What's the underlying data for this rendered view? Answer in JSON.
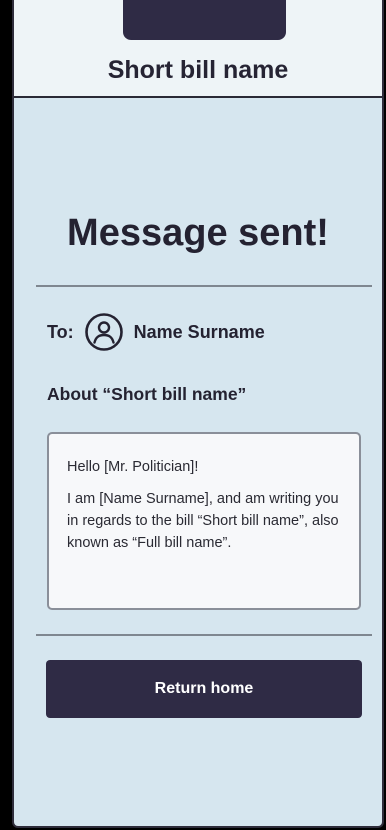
{
  "header": {
    "title": "Short bill name"
  },
  "main": {
    "title": "Message sent!",
    "to_label": "To:",
    "recipient_name": "Name Surname",
    "avatar_icon": "user-circle-icon",
    "about": "About “Short bill name”",
    "message": {
      "greeting": "Hello [Mr. Politician]!",
      "body": "I am [Name Surname], and am writing you in regards to the bill “Short bill name”, also known as “Full bill name”."
    },
    "return_button_label": "Return home"
  },
  "colors": {
    "background": "#d6e6ef",
    "header_background": "#eef4f7",
    "primary_dark": "#2f2b45",
    "text": "#242231"
  }
}
